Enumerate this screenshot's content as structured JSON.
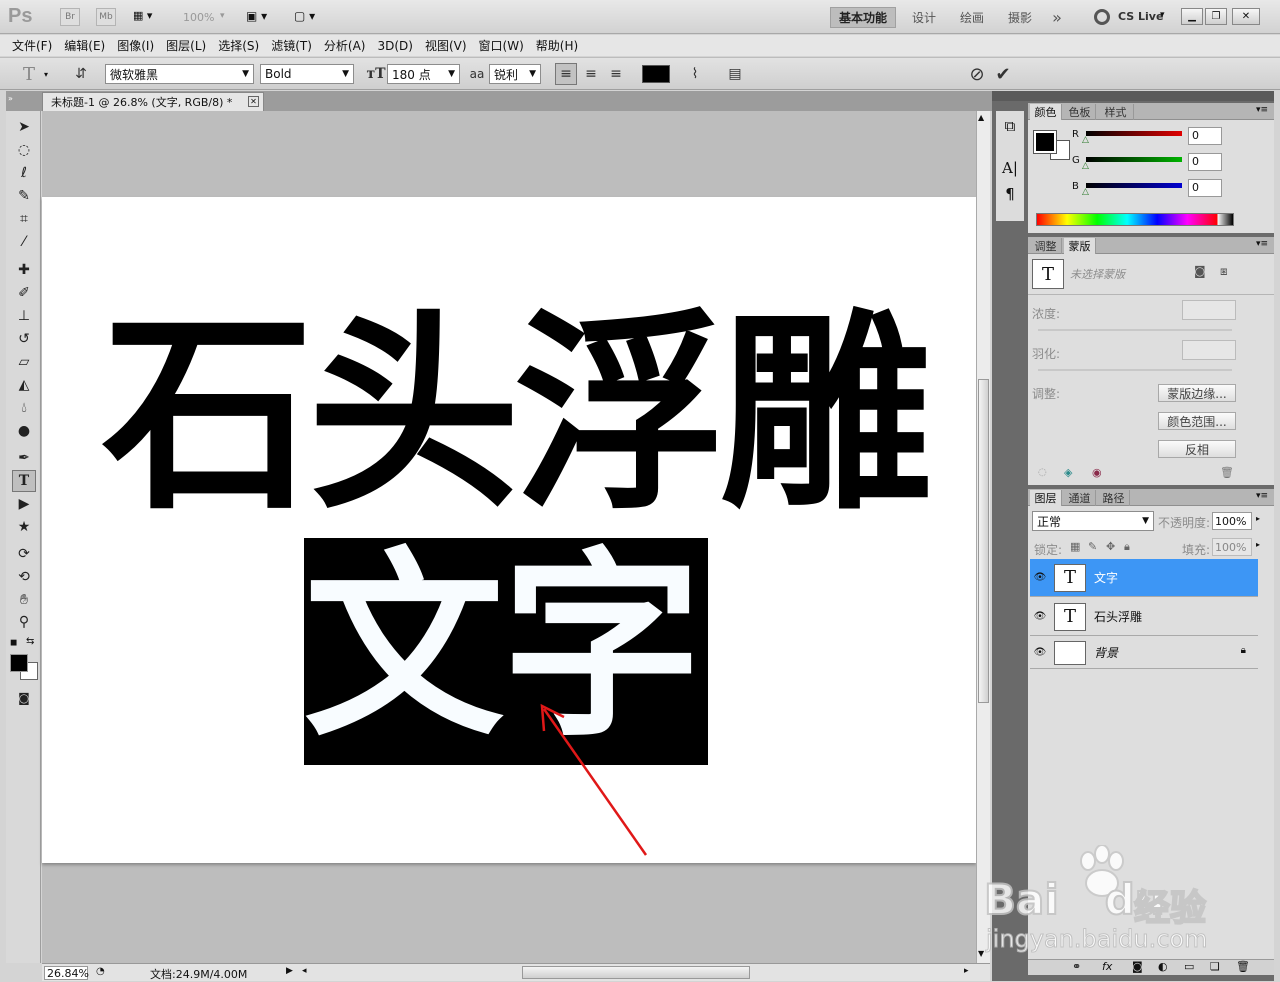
{
  "appbar": {
    "logo": "Ps",
    "bridge": "Br",
    "minibridge": "Mb",
    "zoom": "100%",
    "workspaces": [
      "基本功能",
      "设计",
      "绘画",
      "摄影"
    ],
    "more": "»",
    "cslive": "CS Live"
  },
  "menu": [
    "文件(F)",
    "编辑(E)",
    "图像(I)",
    "图层(L)",
    "选择(S)",
    "滤镜(T)",
    "分析(A)",
    "3D(D)",
    "视图(V)",
    "窗口(W)",
    "帮助(H)"
  ],
  "options": {
    "font_family": "微软雅黑",
    "font_style": "Bold",
    "font_size": "180 点",
    "aa_label": "aa",
    "antialias": "锐利",
    "text_color": "#000000"
  },
  "document": {
    "tab_title": "未标题-1 @ 26.8% (文字, RGB/8) *",
    "line1": "石头浮雕",
    "line2": "文字"
  },
  "status": {
    "zoom": "26.84%",
    "doc_size": "文档:24.9M/4.00M"
  },
  "color_panel": {
    "tabs": [
      "颜色",
      "色板",
      "样式"
    ],
    "channels": [
      {
        "label": "R",
        "value": "0",
        "color": "#e00000"
      },
      {
        "label": "G",
        "value": "0",
        "color": "#00b400"
      },
      {
        "label": "B",
        "value": "0",
        "color": "#0000d0"
      }
    ]
  },
  "masks_panel": {
    "tabs": [
      "调整",
      "蒙版"
    ],
    "no_mask": "未选择蒙版",
    "density_label": "浓度:",
    "feather_label": "羽化:",
    "refine_label": "调整:",
    "buttons": [
      "蒙版边缘...",
      "颜色范围...",
      "反相"
    ]
  },
  "layers_panel": {
    "tabs": [
      "图层",
      "通道",
      "路径"
    ],
    "blend_mode": "正常",
    "opacity_label": "不透明度:",
    "opacity": "100%",
    "lock_label": "锁定:",
    "fill_label": "填充:",
    "fill": "100%",
    "layers": [
      {
        "name": "文字",
        "thumb": "T",
        "selected": true
      },
      {
        "name": "石头浮雕",
        "thumb": "T",
        "selected": false
      },
      {
        "name": "背景",
        "thumb": "",
        "selected": false
      }
    ]
  },
  "watermark": {
    "brand": "Bai",
    "brand2": "du",
    "cn": "经验",
    "url": "jingyan.baidu.com"
  }
}
